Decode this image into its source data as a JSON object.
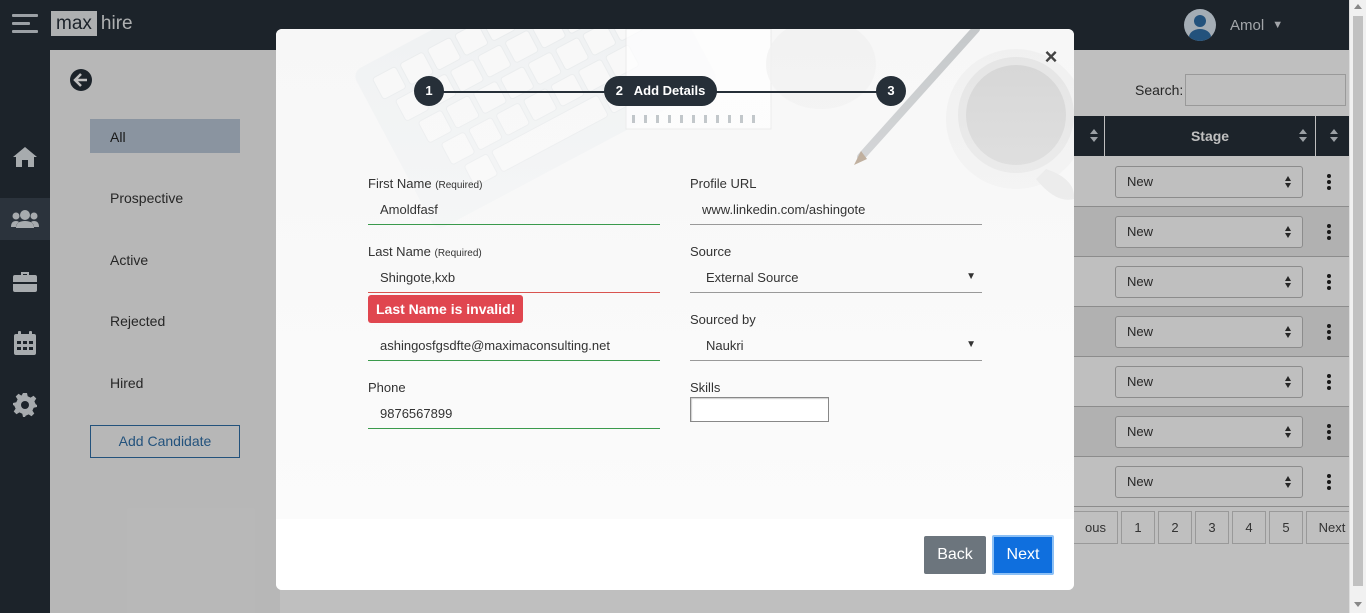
{
  "app": {
    "logo_left": "max",
    "logo_right": "hire"
  },
  "user": {
    "name": "Amol"
  },
  "sidebar": {
    "filters": [
      {
        "label": "All"
      },
      {
        "label": "Prospective"
      },
      {
        "label": "Active"
      },
      {
        "label": "Rejected"
      },
      {
        "label": "Hired"
      }
    ],
    "add_candidate_label": "Add Candidate"
  },
  "table": {
    "search_label": "Search:",
    "stage_header": "Stage",
    "rows": [
      {
        "stage": "New"
      },
      {
        "stage": "New"
      },
      {
        "stage": "New"
      },
      {
        "stage": "New"
      },
      {
        "stage": "New"
      },
      {
        "stage": "New"
      },
      {
        "stage": "New"
      }
    ],
    "pagination": [
      "ous",
      "1",
      "2",
      "3",
      "4",
      "5",
      "Next"
    ]
  },
  "modal": {
    "close_glyph": "×",
    "steps": [
      {
        "number": "1",
        "label": ""
      },
      {
        "number": "2",
        "label": "Add Details"
      },
      {
        "number": "3",
        "label": ""
      }
    ],
    "fields": {
      "first_name": {
        "label": "First Name",
        "hint": "(Required)",
        "value": "Amoldfasf"
      },
      "last_name": {
        "label": "Last Name",
        "hint": "(Required)",
        "value": "Shingote,kxb",
        "error": "Last Name is invalid!"
      },
      "email": {
        "value": "ashingosfgsdfte@maximaconsulting.net"
      },
      "phone": {
        "label": "Phone",
        "value": "9876567899"
      },
      "profile_url": {
        "label": "Profile URL",
        "value": "www.linkedin.com/ashingote"
      },
      "source": {
        "label": "Source",
        "value": "External Source"
      },
      "sourced_by": {
        "label": "Sourced by",
        "value": "Naukri"
      },
      "skills": {
        "label": "Skills",
        "value": ""
      }
    },
    "back_label": "Back",
    "next_label": "Next"
  },
  "colors": {
    "dark_nav": "#262f38",
    "primary": "#0f6fde",
    "error": "#e0464f",
    "valid": "#3a9a4c"
  }
}
